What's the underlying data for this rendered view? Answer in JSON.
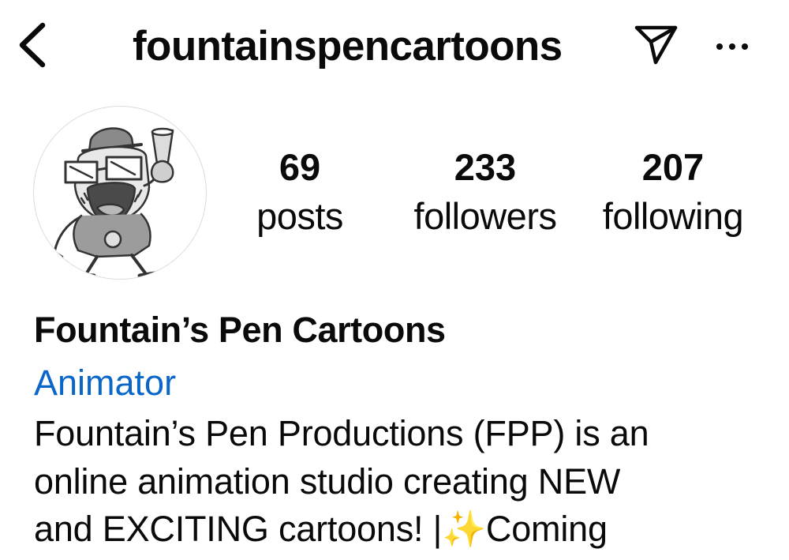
{
  "header": {
    "username": "fountainspencartoons",
    "icons": {
      "back": "chevron-left-icon",
      "send": "paper-plane-icon",
      "more": "more-horizontal-icon"
    }
  },
  "profile": {
    "avatar": "cartoon-character-avatar",
    "stats": [
      {
        "value": "69",
        "label": "posts"
      },
      {
        "value": "233",
        "label": "followers"
      },
      {
        "value": "207",
        "label": "following"
      }
    ],
    "display_name": "Fountain’s Pen Cartoons",
    "category": "Animator",
    "bio_lines": [
      "Fountain’s Pen Productions (FPP) is an",
      "online animation studio creating NEW",
      "and EXCITING cartoons! |✨Coming"
    ]
  },
  "colors": {
    "text": "#0a0a0a",
    "link_blue": "#0a67c9",
    "avatar_border": "#dbdbdb"
  }
}
